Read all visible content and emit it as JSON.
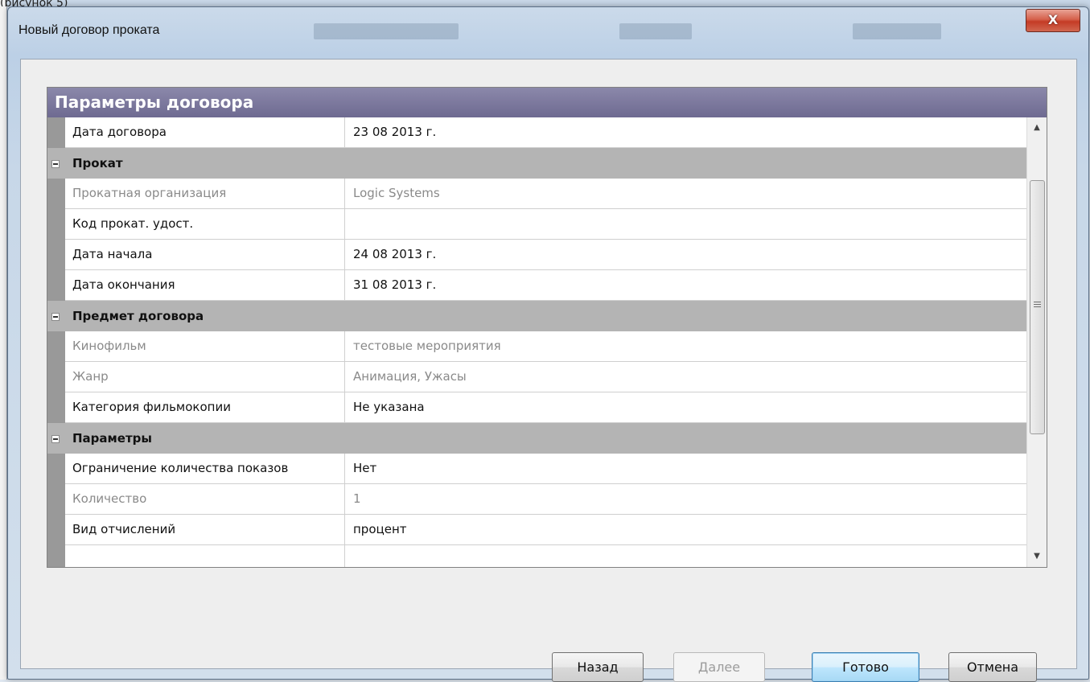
{
  "background": {
    "title_fragment": "(рисунок 5)"
  },
  "dialog": {
    "title": "Новый договор проката",
    "close_glyph": "X"
  },
  "grid": {
    "header": "Параметры договора",
    "top_row": {
      "name": "Дата договора",
      "value": "23 08 2013 г.",
      "readonly": false
    },
    "categories": [
      {
        "label": "Прокат",
        "items": [
          {
            "name": "Прокатная организация",
            "value": "Logic Systems",
            "readonly": true
          },
          {
            "name": "Код прокат. удост.",
            "value": "",
            "readonly": false
          },
          {
            "name": "Дата начала",
            "value": "24 08 2013 г.",
            "readonly": false
          },
          {
            "name": "Дата окончания",
            "value": "31 08 2013 г.",
            "readonly": false
          }
        ]
      },
      {
        "label": "Предмет договора",
        "items": [
          {
            "name": "Кинофильм",
            "value": "тестовые мероприятия",
            "readonly": true
          },
          {
            "name": "Жанр",
            "value": "Анимация, Ужасы",
            "readonly": true
          },
          {
            "name": "Категория фильмокопии",
            "value": "Не указана",
            "readonly": false
          }
        ]
      },
      {
        "label": "Параметры",
        "items": [
          {
            "name": "Ограничение количества показов",
            "value": "Нет",
            "readonly": false
          },
          {
            "name": "Количество",
            "value": "1",
            "readonly": true
          },
          {
            "name": "Вид отчислений",
            "value": "процент",
            "readonly": false
          }
        ]
      }
    ],
    "scroll_up_glyph": "▲",
    "scroll_down_glyph": "▼",
    "scroll_position": 0.35
  },
  "buttons": {
    "back": "Назад",
    "next": "Далее",
    "done": "Готово",
    "cancel": "Отмена"
  },
  "colors": {
    "header_bg": "#7a779c",
    "category_bg": "#b4b4b4",
    "close_button": "#c43b25"
  }
}
